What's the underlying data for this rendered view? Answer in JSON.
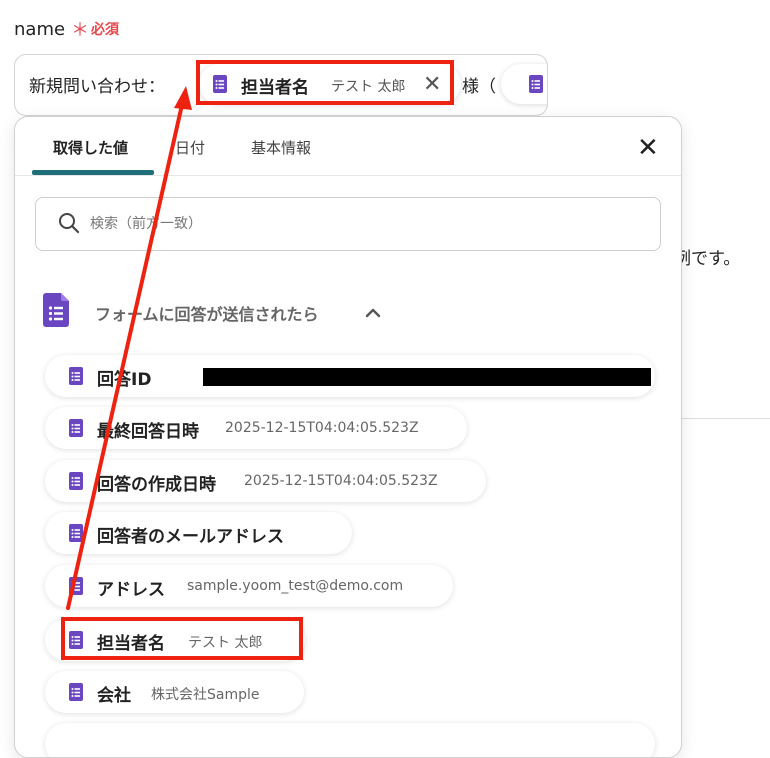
{
  "field": {
    "label": "name",
    "required_star": "＊",
    "required_text": "必須"
  },
  "input": {
    "prefix": "新規問い合わせ：",
    "chip": {
      "label": "担当者名",
      "value": "テスト 太郎"
    },
    "close_glyph": "✕",
    "suffix": "様（"
  },
  "background_text": "例です。",
  "dropdown": {
    "tabs": [
      "取得した値",
      "日付",
      "基本情報"
    ],
    "active_tab": 0,
    "close_glyph": "✕",
    "search": {
      "placeholder": "検索（前方一致）"
    },
    "group": {
      "label": "フォームに回答が送信されたら"
    },
    "items": [
      {
        "label": "回答ID",
        "value": ""
      },
      {
        "label": "最終回答日時",
        "value": "2025-12-15T04:04:05.523Z"
      },
      {
        "label": "回答の作成日時",
        "value": "2025-12-15T04:04:05.523Z"
      },
      {
        "label": "回答者のメールアドレス",
        "value": ""
      },
      {
        "label": "アドレス",
        "value": "sample.yoom_test@demo.com"
      },
      {
        "label": "担当者名",
        "value": "テスト 太郎"
      },
      {
        "label": "会社",
        "value": "株式会社Sample"
      }
    ]
  },
  "colors": {
    "accent": "#1f6f7a",
    "required": "#e5484d",
    "highlight": "#ee2211",
    "forms_icon": "#6b46c1"
  }
}
